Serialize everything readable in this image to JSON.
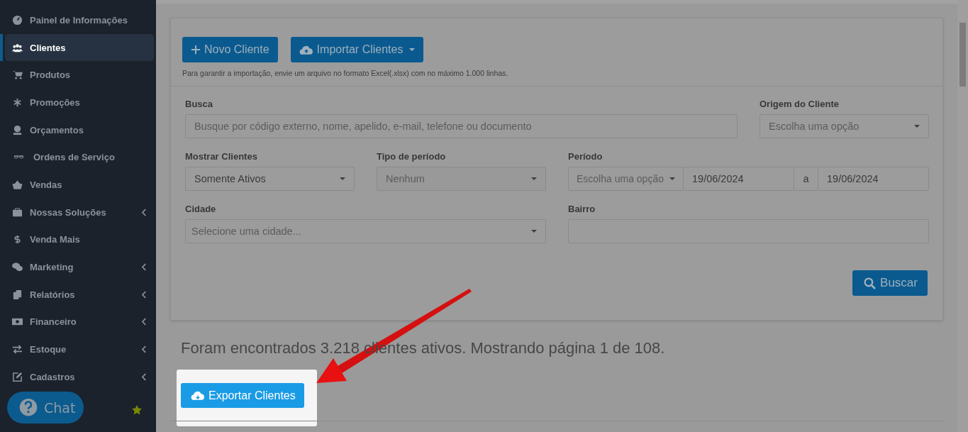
{
  "sidebar": {
    "items": [
      {
        "label": "Painel de Informações",
        "selected": false,
        "has_submenu": false
      },
      {
        "label": "Clientes",
        "selected": true,
        "has_submenu": false
      },
      {
        "label": "Produtos",
        "selected": false,
        "has_submenu": false
      },
      {
        "label": "Promoções",
        "selected": false,
        "has_submenu": false
      },
      {
        "label": "Orçamentos",
        "selected": false,
        "has_submenu": false
      },
      {
        "label": "Ordens de Serviço",
        "selected": false,
        "has_submenu": false
      },
      {
        "label": "Vendas",
        "selected": false,
        "has_submenu": false
      },
      {
        "label": "Nossas Soluções",
        "selected": false,
        "has_submenu": true
      },
      {
        "label": "Venda Mais",
        "selected": false,
        "has_submenu": false
      },
      {
        "label": "Marketing",
        "selected": false,
        "has_submenu": true
      },
      {
        "label": "Relatórios",
        "selected": false,
        "has_submenu": true
      },
      {
        "label": "Financeiro",
        "selected": false,
        "has_submenu": true
      },
      {
        "label": "Estoque",
        "selected": false,
        "has_submenu": true
      },
      {
        "label": "Cadastros",
        "selected": false,
        "has_submenu": true
      }
    ]
  },
  "chat": {
    "label": "Chat"
  },
  "toolbar": {
    "buttons": [
      {
        "label": "Novo Cliente",
        "kind": "plus"
      },
      {
        "label": "Importar Clientes",
        "kind": "upload"
      }
    ],
    "note": "Para garantir a importação, envie um arquivo no formato Excel(.xlsx) com no máximo 1.000 linhas."
  },
  "filters": {
    "search": {
      "label": "Busca",
      "placeholder": "Busque por código externo, nome, apelido, e-mail, telefone ou documento"
    },
    "origin": {
      "label": "Origem do Cliente",
      "placeholder": "Escolha uma opção"
    },
    "show": {
      "label": "Mostrar Clientes",
      "value": "Somente Ativos"
    },
    "period_type": {
      "label": "Tipo de período",
      "value": "Nenhum",
      "disabled": true
    },
    "period": {
      "label": "Período",
      "select_placeholder": "Escolha uma opção",
      "from": "19/06/2024",
      "separator": "a",
      "to": "19/06/2024"
    },
    "city": {
      "label": "Cidade",
      "placeholder": "Selecione uma cidade..."
    },
    "district": {
      "label": "Bairro"
    },
    "search_button": "Buscar"
  },
  "result_text": "Foram encontrados 3.218 clientes ativos. Mostrando página 1 de 108.",
  "export_button": "Exportar Clientes"
}
